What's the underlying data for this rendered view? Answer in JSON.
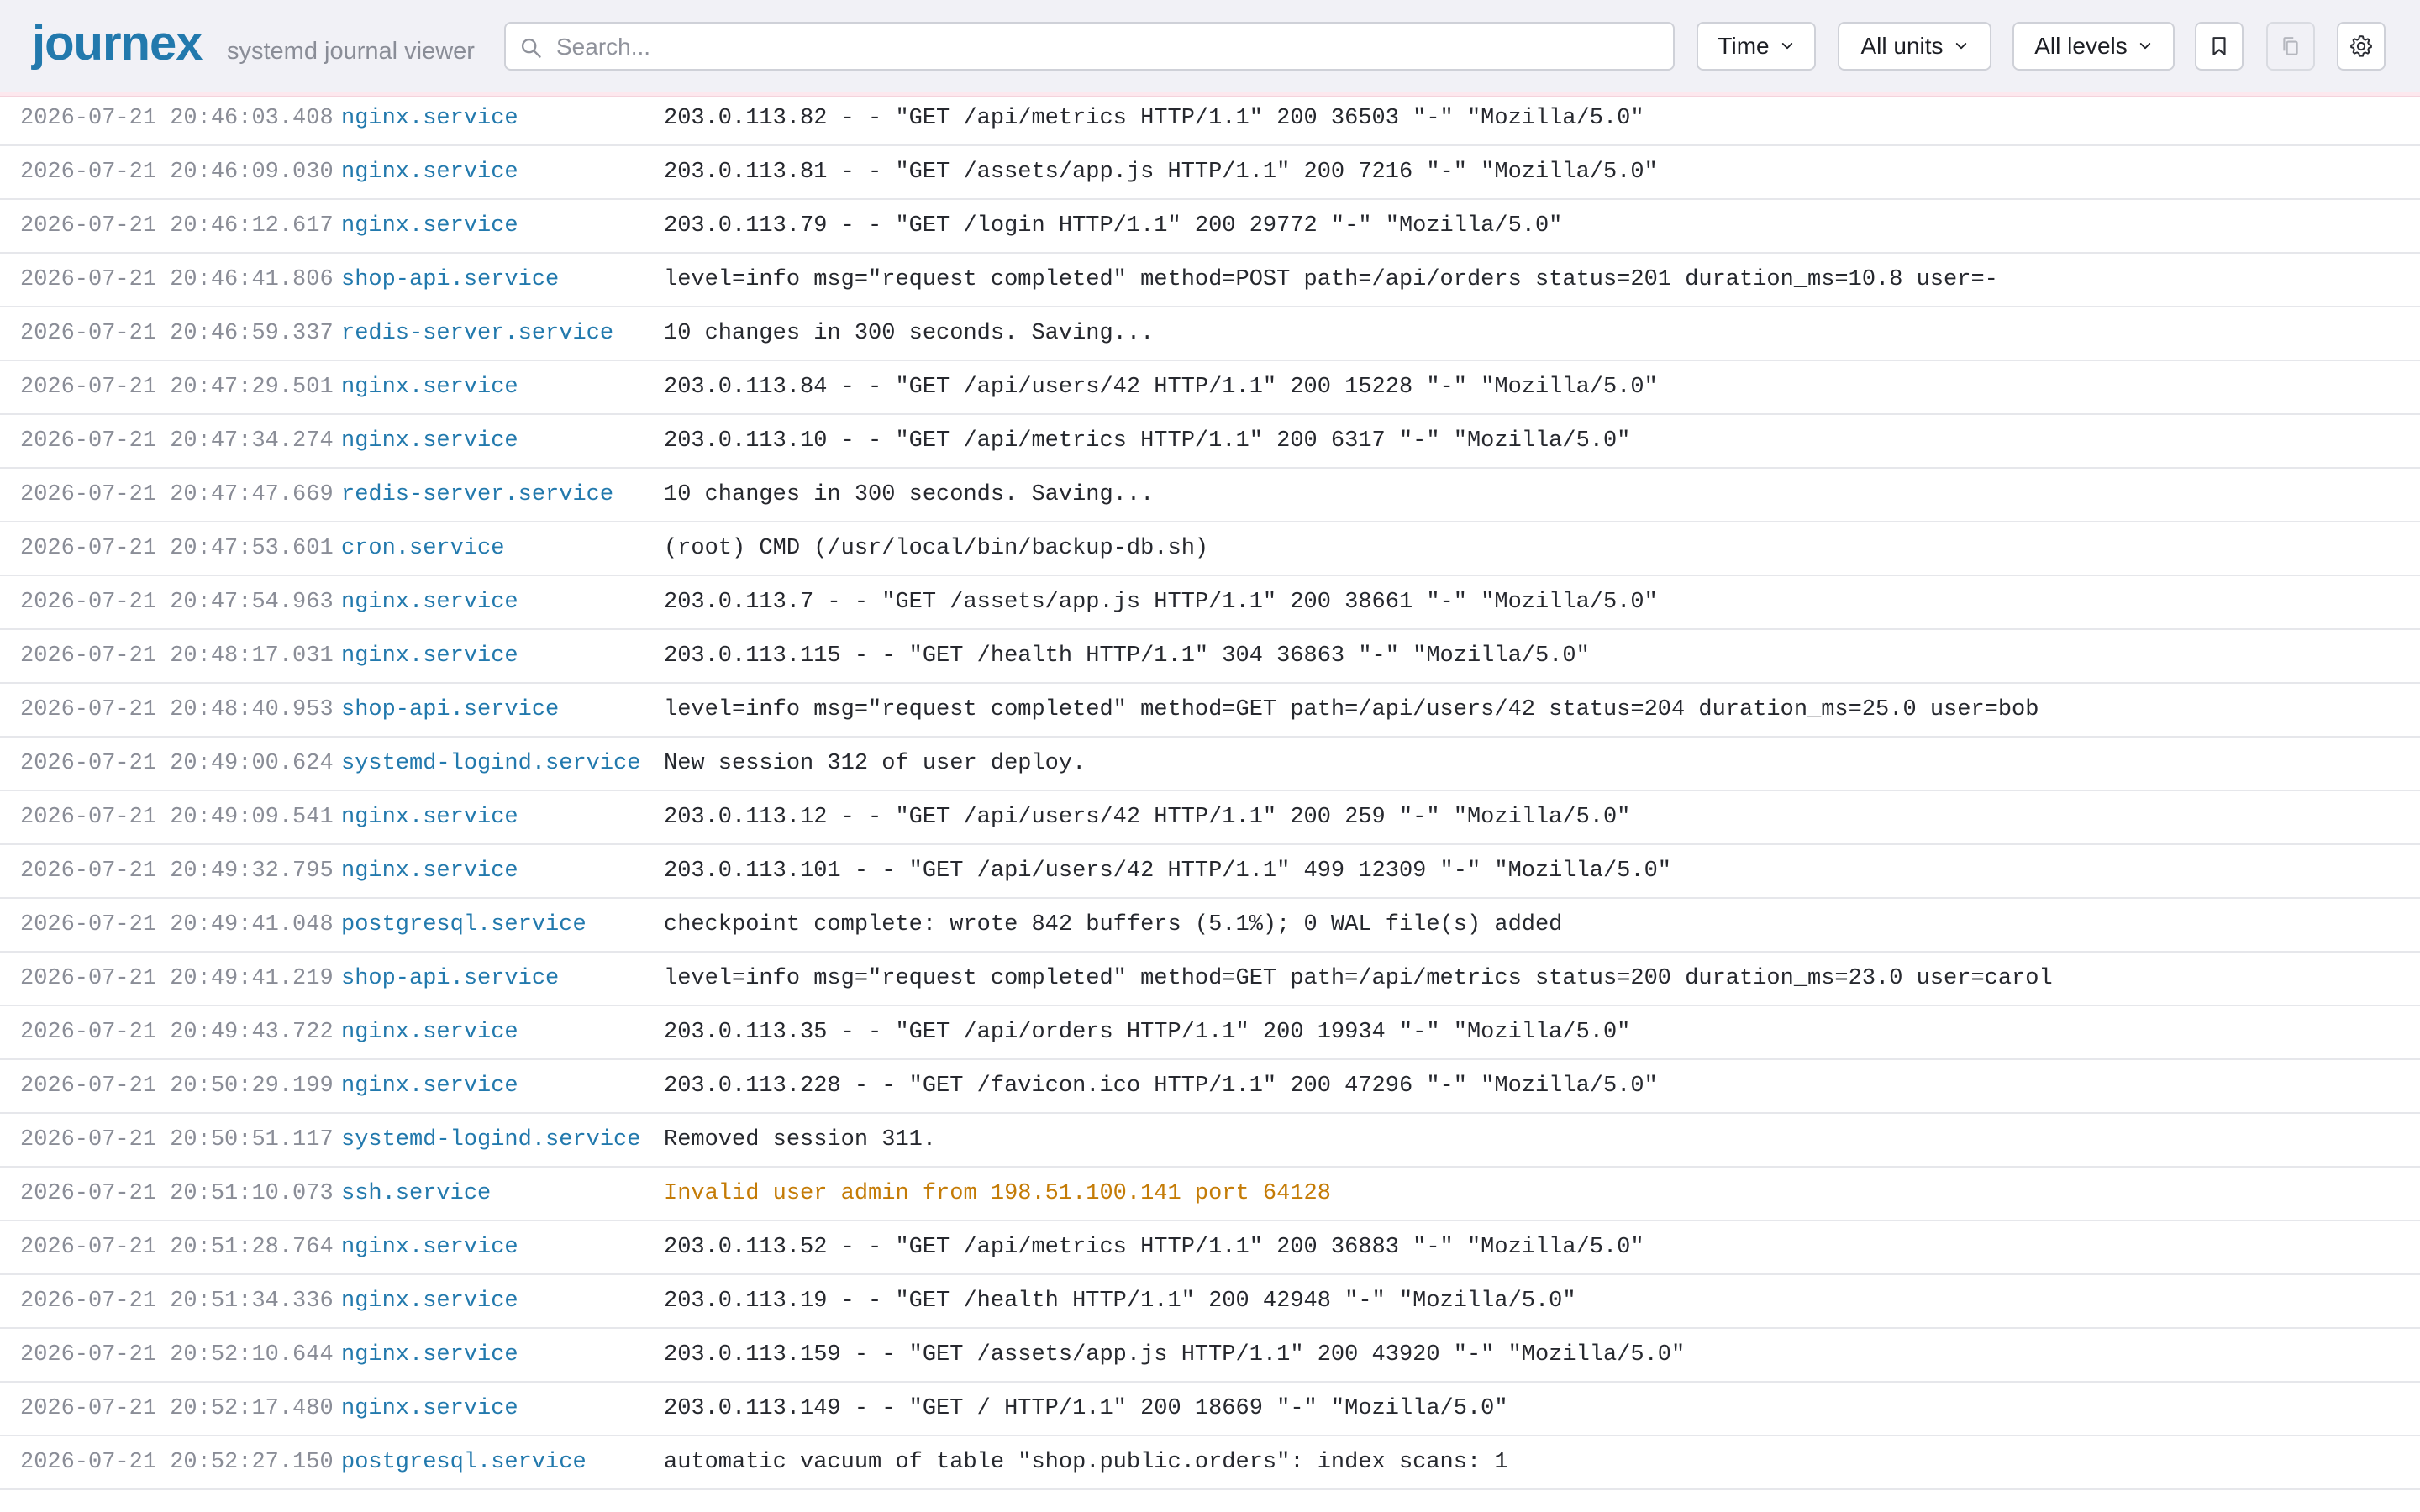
{
  "app": {
    "brand": "journex",
    "subtitle": "systemd journal viewer"
  },
  "toolbar": {
    "search_placeholder": "Search...",
    "time_label": "Time",
    "units_label": "All units",
    "levels_label": "All levels",
    "icons": [
      "bookmark-icon",
      "copy-icon",
      "gear-icon"
    ]
  },
  "colors": {
    "brand": "#2279ad",
    "unit": "#2279ad",
    "warning": "#c47b06",
    "error_row_bg": "#fde8ee"
  },
  "entries": [
    {
      "ts": "2026-07-21 20:46:03.408",
      "unit": "nginx.service",
      "msg": "203.0.113.82 - - \"GET /api/metrics HTTP/1.1\" 200 36503 \"-\" \"Mozilla/5.0\"",
      "level": "info"
    },
    {
      "ts": "2026-07-21 20:46:09.030",
      "unit": "nginx.service",
      "msg": "203.0.113.81 - - \"GET /assets/app.js HTTP/1.1\" 200 7216 \"-\" \"Mozilla/5.0\"",
      "level": "info"
    },
    {
      "ts": "2026-07-21 20:46:12.617",
      "unit": "nginx.service",
      "msg": "203.0.113.79 - - \"GET /login HTTP/1.1\" 200 29772 \"-\" \"Mozilla/5.0\"",
      "level": "info"
    },
    {
      "ts": "2026-07-21 20:46:41.806",
      "unit": "shop-api.service",
      "msg": "level=info msg=\"request completed\" method=POST path=/api/orders status=201 duration_ms=10.8 user=-",
      "level": "info"
    },
    {
      "ts": "2026-07-21 20:46:59.337",
      "unit": "redis-server.service",
      "msg": "10 changes in 300 seconds. Saving...",
      "level": "info"
    },
    {
      "ts": "2026-07-21 20:47:29.501",
      "unit": "nginx.service",
      "msg": "203.0.113.84 - - \"GET /api/users/42 HTTP/1.1\" 200 15228 \"-\" \"Mozilla/5.0\"",
      "level": "info"
    },
    {
      "ts": "2026-07-21 20:47:34.274",
      "unit": "nginx.service",
      "msg": "203.0.113.10 - - \"GET /api/metrics HTTP/1.1\" 200 6317 \"-\" \"Mozilla/5.0\"",
      "level": "info"
    },
    {
      "ts": "2026-07-21 20:47:47.669",
      "unit": "redis-server.service",
      "msg": "10 changes in 300 seconds. Saving...",
      "level": "info"
    },
    {
      "ts": "2026-07-21 20:47:53.601",
      "unit": "cron.service",
      "msg": "(root) CMD (/usr/local/bin/backup-db.sh)",
      "level": "info"
    },
    {
      "ts": "2026-07-21 20:47:54.963",
      "unit": "nginx.service",
      "msg": "203.0.113.7 - - \"GET /assets/app.js HTTP/1.1\" 200 38661 \"-\" \"Mozilla/5.0\"",
      "level": "info"
    },
    {
      "ts": "2026-07-21 20:48:17.031",
      "unit": "nginx.service",
      "msg": "203.0.113.115 - - \"GET /health HTTP/1.1\" 304 36863 \"-\" \"Mozilla/5.0\"",
      "level": "info"
    },
    {
      "ts": "2026-07-21 20:48:40.953",
      "unit": "shop-api.service",
      "msg": "level=info msg=\"request completed\" method=GET path=/api/users/42 status=204 duration_ms=25.0 user=bob",
      "level": "info"
    },
    {
      "ts": "2026-07-21 20:49:00.624",
      "unit": "systemd-logind.service",
      "msg": "New session 312 of user deploy.",
      "level": "info"
    },
    {
      "ts": "2026-07-21 20:49:09.541",
      "unit": "nginx.service",
      "msg": "203.0.113.12 - - \"GET /api/users/42 HTTP/1.1\" 200 259 \"-\" \"Mozilla/5.0\"",
      "level": "info"
    },
    {
      "ts": "2026-07-21 20:49:32.795",
      "unit": "nginx.service",
      "msg": "203.0.113.101 - - \"GET /api/users/42 HTTP/1.1\" 499 12309 \"-\" \"Mozilla/5.0\"",
      "level": "info"
    },
    {
      "ts": "2026-07-21 20:49:41.048",
      "unit": "postgresql.service",
      "msg": "checkpoint complete: wrote 842 buffers (5.1%); 0 WAL file(s) added",
      "level": "info"
    },
    {
      "ts": "2026-07-21 20:49:41.219",
      "unit": "shop-api.service",
      "msg": "level=info msg=\"request completed\" method=GET path=/api/metrics status=200 duration_ms=23.0 user=carol",
      "level": "info"
    },
    {
      "ts": "2026-07-21 20:49:43.722",
      "unit": "nginx.service",
      "msg": "203.0.113.35 - - \"GET /api/orders HTTP/1.1\" 200 19934 \"-\" \"Mozilla/5.0\"",
      "level": "info"
    },
    {
      "ts": "2026-07-21 20:50:29.199",
      "unit": "nginx.service",
      "msg": "203.0.113.228 - - \"GET /favicon.ico HTTP/1.1\" 200 47296 \"-\" \"Mozilla/5.0\"",
      "level": "info"
    },
    {
      "ts": "2026-07-21 20:50:51.117",
      "unit": "systemd-logind.service",
      "msg": "Removed session 311.",
      "level": "info"
    },
    {
      "ts": "2026-07-21 20:51:10.073",
      "unit": "ssh.service",
      "msg": "Invalid user admin from 198.51.100.141 port 64128",
      "level": "warning"
    },
    {
      "ts": "2026-07-21 20:51:28.764",
      "unit": "nginx.service",
      "msg": "203.0.113.52 - - \"GET /api/metrics HTTP/1.1\" 200 36883 \"-\" \"Mozilla/5.0\"",
      "level": "info"
    },
    {
      "ts": "2026-07-21 20:51:34.336",
      "unit": "nginx.service",
      "msg": "203.0.113.19 - - \"GET /health HTTP/1.1\" 200 42948 \"-\" \"Mozilla/5.0\"",
      "level": "info"
    },
    {
      "ts": "2026-07-21 20:52:10.644",
      "unit": "nginx.service",
      "msg": "203.0.113.159 - - \"GET /assets/app.js HTTP/1.1\" 200 43920 \"-\" \"Mozilla/5.0\"",
      "level": "info"
    },
    {
      "ts": "2026-07-21 20:52:17.480",
      "unit": "nginx.service",
      "msg": "203.0.113.149 - - \"GET / HTTP/1.1\" 200 18669 \"-\" \"Mozilla/5.0\"",
      "level": "info"
    },
    {
      "ts": "2026-07-21 20:52:27.150",
      "unit": "postgresql.service",
      "msg": "automatic vacuum of table \"shop.public.orders\": index scans: 1",
      "level": "info"
    }
  ]
}
